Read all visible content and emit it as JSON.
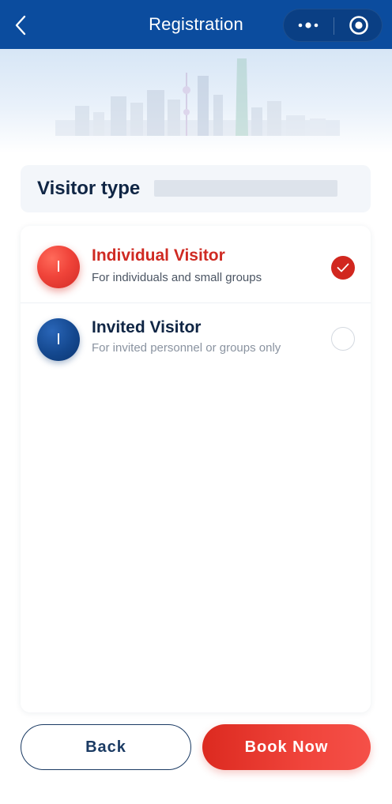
{
  "navbar": {
    "title": "Registration",
    "back_icon": "chevron-left-icon",
    "more_icon": "more-dots-icon",
    "close_icon": "target-close-icon",
    "color": "#0b4c9e"
  },
  "banner": {
    "illustration": "city-skyline-illustration"
  },
  "visitor_type": {
    "label": "Visitor type"
  },
  "options": [
    {
      "avatar_letter": "I",
      "title": "Individual Visitor",
      "subtitle": "For individuals and small groups",
      "selected": true,
      "accent": "#cf2a22"
    },
    {
      "avatar_letter": "I",
      "title": "Invited Visitor",
      "subtitle": "For invited personnel or groups only",
      "selected": false,
      "accent": "#14488f"
    }
  ],
  "actions": {
    "back_label": "Back",
    "book_label": "Book Now",
    "primary_color": "#e8332a"
  }
}
